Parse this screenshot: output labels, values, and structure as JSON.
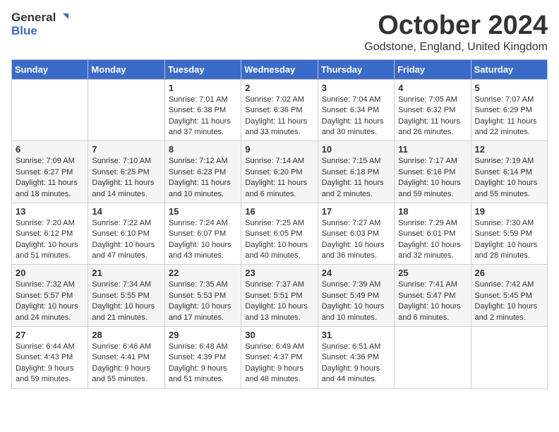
{
  "logo": {
    "general": "General",
    "blue": "Blue"
  },
  "title": {
    "month": "October 2024",
    "location": "Godstone, England, United Kingdom"
  },
  "days_of_week": [
    "Sunday",
    "Monday",
    "Tuesday",
    "Wednesday",
    "Thursday",
    "Friday",
    "Saturday"
  ],
  "weeks": [
    [
      {
        "day": "",
        "content": ""
      },
      {
        "day": "",
        "content": ""
      },
      {
        "day": "1",
        "content": "Sunrise: 7:01 AM\nSunset: 6:38 PM\nDaylight: 11 hours and 37 minutes."
      },
      {
        "day": "2",
        "content": "Sunrise: 7:02 AM\nSunset: 6:36 PM\nDaylight: 11 hours and 33 minutes."
      },
      {
        "day": "3",
        "content": "Sunrise: 7:04 AM\nSunset: 6:34 PM\nDaylight: 11 hours and 30 minutes."
      },
      {
        "day": "4",
        "content": "Sunrise: 7:05 AM\nSunset: 6:32 PM\nDaylight: 11 hours and 26 minutes."
      },
      {
        "day": "5",
        "content": "Sunrise: 7:07 AM\nSunset: 6:29 PM\nDaylight: 11 hours and 22 minutes."
      }
    ],
    [
      {
        "day": "6",
        "content": "Sunrise: 7:09 AM\nSunset: 6:27 PM\nDaylight: 11 hours and 18 minutes."
      },
      {
        "day": "7",
        "content": "Sunrise: 7:10 AM\nSunset: 6:25 PM\nDaylight: 11 hours and 14 minutes."
      },
      {
        "day": "8",
        "content": "Sunrise: 7:12 AM\nSunset: 6:23 PM\nDaylight: 11 hours and 10 minutes."
      },
      {
        "day": "9",
        "content": "Sunrise: 7:14 AM\nSunset: 6:20 PM\nDaylight: 11 hours and 6 minutes."
      },
      {
        "day": "10",
        "content": "Sunrise: 7:15 AM\nSunset: 6:18 PM\nDaylight: 11 hours and 2 minutes."
      },
      {
        "day": "11",
        "content": "Sunrise: 7:17 AM\nSunset: 6:16 PM\nDaylight: 10 hours and 59 minutes."
      },
      {
        "day": "12",
        "content": "Sunrise: 7:19 AM\nSunset: 6:14 PM\nDaylight: 10 hours and 55 minutes."
      }
    ],
    [
      {
        "day": "13",
        "content": "Sunrise: 7:20 AM\nSunset: 6:12 PM\nDaylight: 10 hours and 51 minutes."
      },
      {
        "day": "14",
        "content": "Sunrise: 7:22 AM\nSunset: 6:10 PM\nDaylight: 10 hours and 47 minutes."
      },
      {
        "day": "15",
        "content": "Sunrise: 7:24 AM\nSunset: 6:07 PM\nDaylight: 10 hours and 43 minutes."
      },
      {
        "day": "16",
        "content": "Sunrise: 7:25 AM\nSunset: 6:05 PM\nDaylight: 10 hours and 40 minutes."
      },
      {
        "day": "17",
        "content": "Sunrise: 7:27 AM\nSunset: 6:03 PM\nDaylight: 10 hours and 36 minutes."
      },
      {
        "day": "18",
        "content": "Sunrise: 7:29 AM\nSunset: 6:01 PM\nDaylight: 10 hours and 32 minutes."
      },
      {
        "day": "19",
        "content": "Sunrise: 7:30 AM\nSunset: 5:59 PM\nDaylight: 10 hours and 28 minutes."
      }
    ],
    [
      {
        "day": "20",
        "content": "Sunrise: 7:32 AM\nSunset: 5:57 PM\nDaylight: 10 hours and 24 minutes."
      },
      {
        "day": "21",
        "content": "Sunrise: 7:34 AM\nSunset: 5:55 PM\nDaylight: 10 hours and 21 minutes."
      },
      {
        "day": "22",
        "content": "Sunrise: 7:35 AM\nSunset: 5:53 PM\nDaylight: 10 hours and 17 minutes."
      },
      {
        "day": "23",
        "content": "Sunrise: 7:37 AM\nSunset: 5:51 PM\nDaylight: 10 hours and 13 minutes."
      },
      {
        "day": "24",
        "content": "Sunrise: 7:39 AM\nSunset: 5:49 PM\nDaylight: 10 hours and 10 minutes."
      },
      {
        "day": "25",
        "content": "Sunrise: 7:41 AM\nSunset: 5:47 PM\nDaylight: 10 hours and 6 minutes."
      },
      {
        "day": "26",
        "content": "Sunrise: 7:42 AM\nSunset: 5:45 PM\nDaylight: 10 hours and 2 minutes."
      }
    ],
    [
      {
        "day": "27",
        "content": "Sunrise: 6:44 AM\nSunset: 4:43 PM\nDaylight: 9 hours and 59 minutes."
      },
      {
        "day": "28",
        "content": "Sunrise: 6:46 AM\nSunset: 4:41 PM\nDaylight: 9 hours and 55 minutes."
      },
      {
        "day": "29",
        "content": "Sunrise: 6:48 AM\nSunset: 4:39 PM\nDaylight: 9 hours and 51 minutes."
      },
      {
        "day": "30",
        "content": "Sunrise: 6:49 AM\nSunset: 4:37 PM\nDaylight: 9 hours and 48 minutes."
      },
      {
        "day": "31",
        "content": "Sunrise: 6:51 AM\nSunset: 4:36 PM\nDaylight: 9 hours and 44 minutes."
      },
      {
        "day": "",
        "content": ""
      },
      {
        "day": "",
        "content": ""
      }
    ]
  ]
}
